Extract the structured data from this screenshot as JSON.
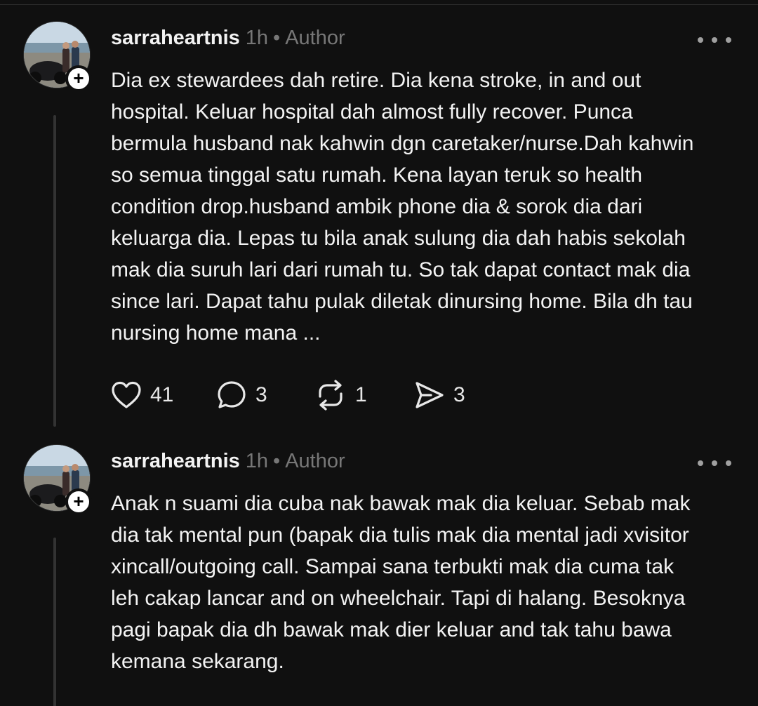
{
  "posts": [
    {
      "username": "sarraheartnis",
      "time": "1h",
      "separator": "•",
      "role": "Author",
      "text": "Dia ex stewardees dah retire. Dia kena stroke, in and out\nhospital. Keluar hospital dah almost fully recover. Punca\nbermula husband nak kahwin dgn caretaker/nurse.Dah kahwin\nso semua tinggal satu rumah. Kena layan teruk so health\ncondition drop.husband ambik phone dia & sorok dia dari\nkeluarga dia. Lepas tu bila anak sulung dia dah habis sekolah\nmak dia suruh lari dari rumah tu. So tak dapat contact mak dia\nsince lari. Dapat tahu pulak diletak dinursing home. Bila dh tau\nnursing home mana ...",
      "likes": "41",
      "replies": "3",
      "reposts": "1",
      "shares": "3"
    },
    {
      "username": "sarraheartnis",
      "time": "1h",
      "separator": "•",
      "role": "Author",
      "text": "Anak n suami dia cuba nak bawak mak dia keluar. Sebab mak\ndia tak mental pun (bapak dia tulis mak dia mental jadi xvisitor\nxincall/outgoing call. Sampai sana terbukti mak dia cuma tak\nleh cakap lancar and on wheelchair. Tapi di halang. Besoknya\npagi bapak dia dh bawak mak dier keluar and tak tahu bawa\nkemana sekarang."
    }
  ],
  "follow_badge": "+",
  "icons": {
    "like": "heart-icon",
    "reply": "comment-icon",
    "repost": "repost-icon",
    "share": "send-icon",
    "more": "more-icon"
  },
  "colors": {
    "background": "#101010",
    "text": "#f3f3f3",
    "muted": "#777777",
    "thread_line": "#333333"
  }
}
